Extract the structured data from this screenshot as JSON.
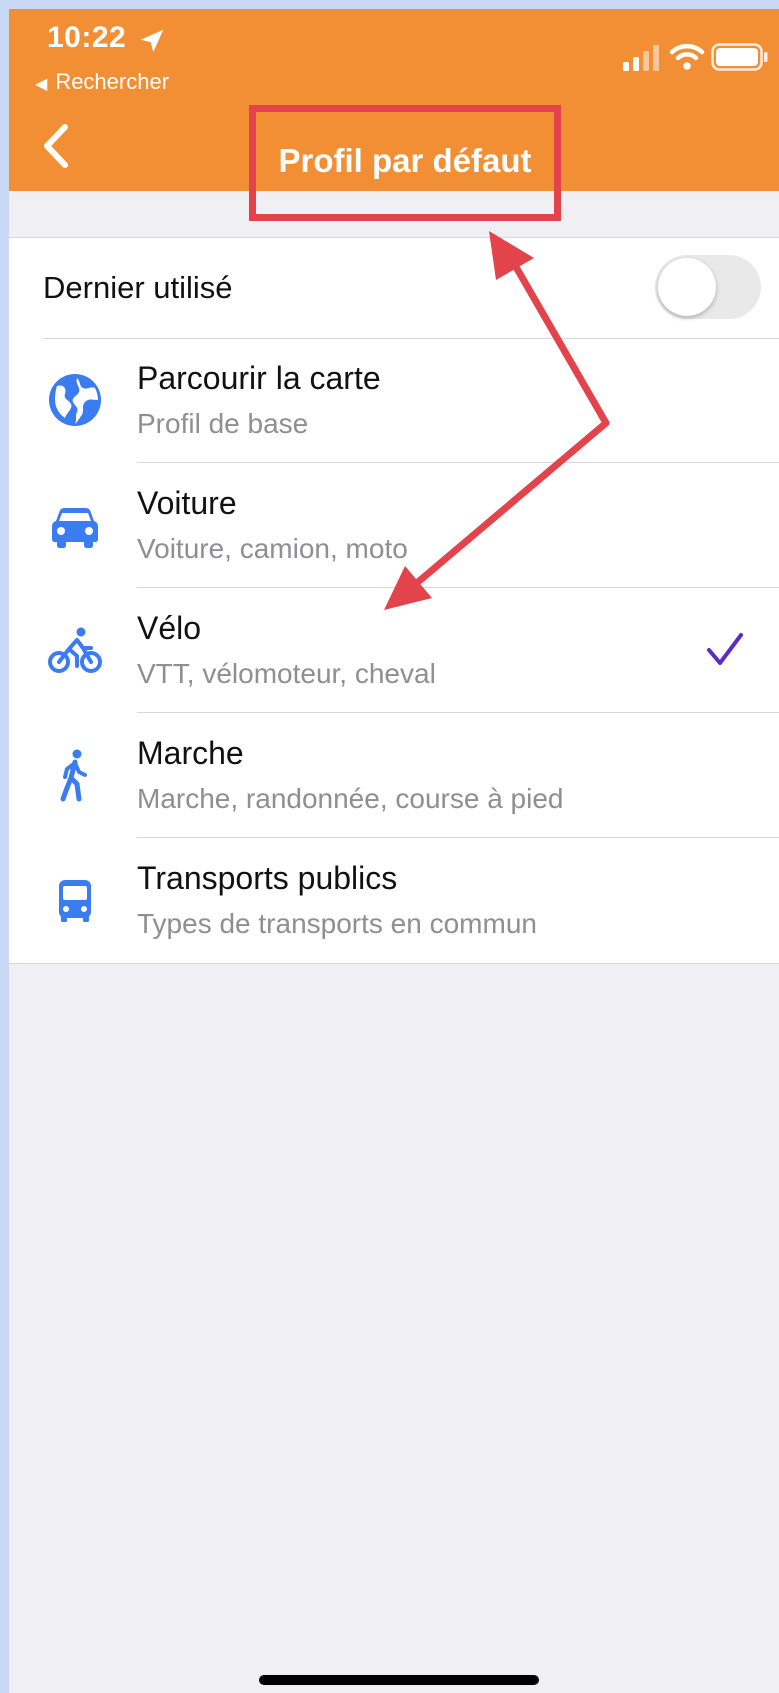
{
  "status_bar": {
    "time": "10:22",
    "back_to_app": "Rechercher"
  },
  "nav": {
    "title": "Profil par défaut"
  },
  "toggle": {
    "label": "Dernier utilisé",
    "on": false
  },
  "profiles": [
    {
      "title": "Parcourir la carte",
      "subtitle": "Profil de base",
      "icon": "globe-icon",
      "selected": false
    },
    {
      "title": "Voiture",
      "subtitle": "Voiture, camion, moto",
      "icon": "car-icon",
      "selected": false
    },
    {
      "title": "Vélo",
      "subtitle": "VTT, vélomoteur, cheval",
      "icon": "bicycle-icon",
      "selected": true
    },
    {
      "title": "Marche",
      "subtitle": "Marche, randonnée, course à pied",
      "icon": "walking-icon",
      "selected": false
    },
    {
      "title": "Transports publics",
      "subtitle": "Types de transports en commun",
      "icon": "bus-icon",
      "selected": false
    }
  ],
  "colors": {
    "header": "#f28f35",
    "icon": "#3b7cf0",
    "checkmark": "#5b2bc9",
    "annotation": "#e3434b"
  }
}
